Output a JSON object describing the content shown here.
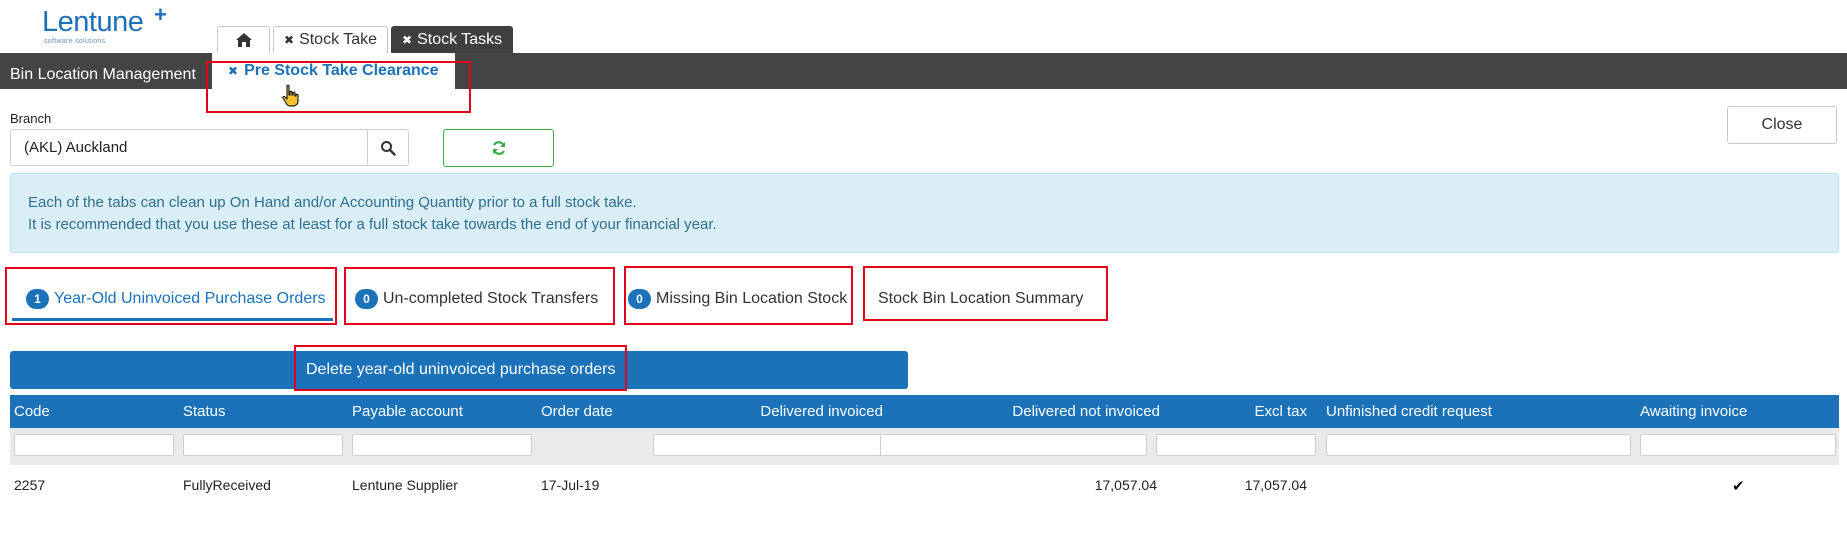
{
  "app": {
    "logo_text": "Lentune",
    "logo_plus": "+",
    "logo_sub": "software solutions"
  },
  "top_tabs": [
    {
      "label": "",
      "icon": "home-icon"
    },
    {
      "label": "Stock Take",
      "closable": true
    },
    {
      "label": "Stock Tasks",
      "closable": true,
      "active": true
    }
  ],
  "subbar": {
    "title": "Bin Location Management",
    "active_tab": "Pre Stock Take Clearance"
  },
  "branch": {
    "label": "Branch",
    "value": "(AKL) Auckland"
  },
  "close_label": "Close",
  "info": {
    "line1": "Each of the tabs can clean up On Hand and/or Accounting Quantity prior to a full stock take.",
    "line2": "It is recommended that you use these at least for a full stock take towards the end of your financial year."
  },
  "tabs": [
    {
      "badge": "1",
      "label": "Year-Old Uninvoiced Purchase Orders",
      "active": true
    },
    {
      "badge": "0",
      "label": "Un-completed Stock Transfers"
    },
    {
      "badge": "0",
      "label": "Missing Bin Location Stock"
    },
    {
      "badge": "",
      "label": "Stock Bin Location Summary"
    }
  ],
  "delete_label": "Delete year-old uninvoiced purchase orders",
  "grid": {
    "columns": [
      "Code",
      "Status",
      "Payable account",
      "Order date",
      "Delivered invoiced",
      "Delivered not invoiced",
      "Excl tax",
      "Unfinished credit request",
      "Awaiting invoice"
    ],
    "rows": [
      {
        "code": "2257",
        "status": "FullyReceived",
        "payable_account": "Lentune Supplier",
        "order_date": "17-Jul-19",
        "delivered_invoiced": "",
        "delivered_not_invoiced": "17,057.04",
        "excl_tax": "17,057.04",
        "unfinished_credit_request": "",
        "awaiting_invoice": "✔"
      }
    ]
  },
  "colors": {
    "brand_blue": "#1b72b8",
    "dark_bar": "#444444",
    "info_bg": "#d9eef7",
    "highlight_red": "#e2001a",
    "refresh_green": "#3da84a"
  }
}
